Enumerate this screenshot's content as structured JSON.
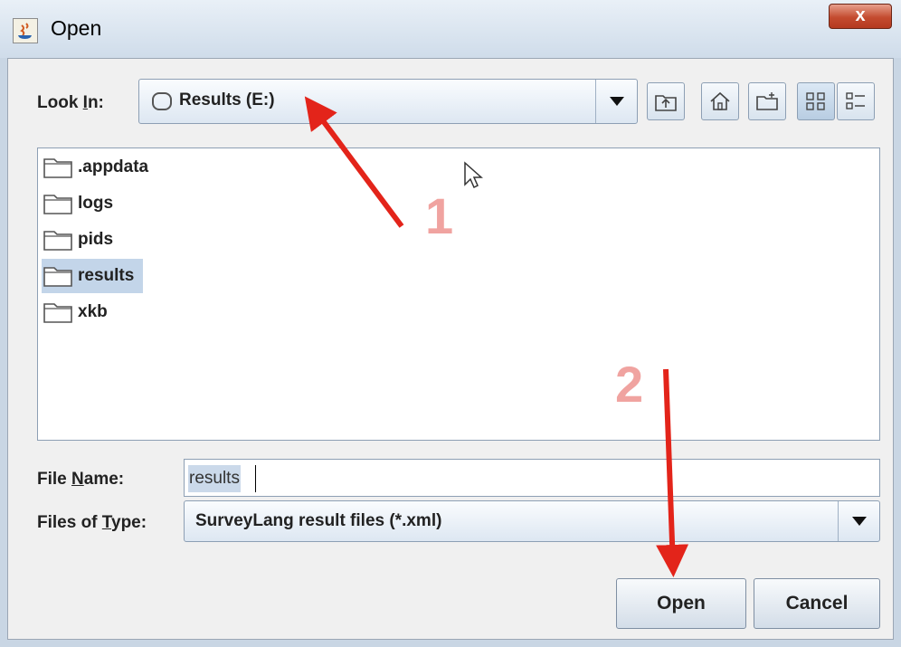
{
  "window": {
    "title": "Open",
    "close_label": "x"
  },
  "look_in": {
    "label_pre": "Look ",
    "label_mnemonic": "I",
    "label_post": "n:",
    "value": "Results (E:)"
  },
  "toolbar": {
    "buttons": [
      {
        "name": "up-one-level-icon"
      },
      {
        "name": "home-icon"
      },
      {
        "name": "new-folder-icon"
      },
      {
        "name": "list-view-icon",
        "active": true
      },
      {
        "name": "details-view-icon"
      }
    ]
  },
  "files": [
    {
      "label": ".appdata"
    },
    {
      "label": "logs"
    },
    {
      "label": "pids"
    },
    {
      "label": "results",
      "selected": true
    },
    {
      "label": "xkb"
    }
  ],
  "file_name": {
    "label_pre": "File ",
    "label_mnemonic": "N",
    "label_post": "ame:",
    "value": "results"
  },
  "file_type": {
    "label_pre": "Files of ",
    "label_mnemonic": "T",
    "label_post": "ype:",
    "value": "SurveyLang result files (*.xml)"
  },
  "buttons": {
    "open": "Open",
    "cancel": "Cancel"
  },
  "annotations": {
    "step1": "1",
    "step2": "2",
    "arrow_color": "#e3241a",
    "number_color": "#f0a3a0"
  }
}
